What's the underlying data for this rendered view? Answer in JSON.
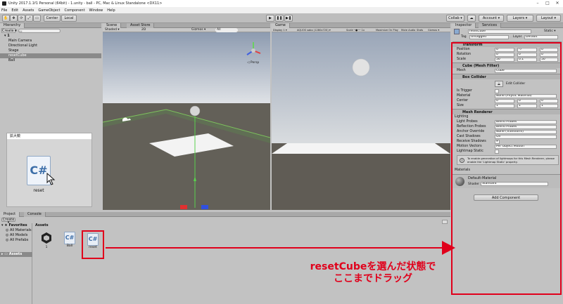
{
  "window": {
    "title": "Unity 2017.1.1f1 Personal (64bit) - 1.unity - ball - PC, Mac & Linux Standalone <DX11>",
    "min": "–",
    "max": "□",
    "close": "✕"
  },
  "menu": [
    "File",
    "Edit",
    "Assets",
    "GameObject",
    "Component",
    "Window",
    "Help"
  ],
  "toolbar": {
    "center": "Center",
    "local": "Local",
    "play": "▶",
    "pause": "❚❚",
    "step": "▶❚",
    "collab": "Collab ▾",
    "account": "Account ▾",
    "layers": "Layers ▾",
    "layout": "Layout ▾",
    "cloud": "☁"
  },
  "hierarchy": {
    "tab": "Hierarchy",
    "create": "Create ▾",
    "search_placeholder": "All",
    "scene": "1",
    "items": [
      "Main Camera",
      "Directional Light",
      "Stage",
      "resetCube",
      "Ball"
    ],
    "selected": 3
  },
  "scene": {
    "tab": "Scene",
    "asset_store": "Asset Store",
    "shading": "Shaded ▾",
    "mode2d": "2D",
    "gizmos": "Gizmos ▾",
    "search": "All",
    "persp": "◁ Persp"
  },
  "game": {
    "tab": "Game",
    "display": "Display 1 ▾",
    "aspect": "AQUOS sabo (1280x720) ▾",
    "scale": "Scale ─●── 1x",
    "maximize": "Maximize On Play",
    "mute": "Mute Audio",
    "stats": "Stats",
    "gizmos": "Gizmos ▾"
  },
  "zoom": {
    "title": "拡大鏡",
    "file_icon": "C#",
    "file_label": "reset"
  },
  "inspector": {
    "tab": "Inspector",
    "services": "Services",
    "object": "resetCube",
    "static": "Static ▾",
    "tag_label": "Tag",
    "tag": "Untagged",
    "layer_label": "Layer",
    "layer": "Default",
    "transform": {
      "title": "Transform",
      "rows": [
        {
          "label": "Position",
          "x": "0",
          "y": "-7",
          "z": "0"
        },
        {
          "label": "Rotation",
          "x": "0",
          "y": "0",
          "z": "0"
        },
        {
          "label": "Scale",
          "x": "50",
          "y": "0.1",
          "z": "50"
        }
      ]
    },
    "meshfilter": {
      "title": "Cube (Mesh Filter)",
      "label": "Mesh",
      "value": "Cube"
    },
    "boxcollider": {
      "title": "Box Collider",
      "edit": "Edit Collider",
      "is_trigger": "Is Trigger",
      "material": "Material",
      "material_value": "None (Physic Material)",
      "center": {
        "label": "Center",
        "x": "0",
        "y": "0",
        "z": "0"
      },
      "size": {
        "label": "Size",
        "x": "1",
        "y": "1",
        "z": "1"
      }
    },
    "meshrenderer": {
      "title": "Mesh Renderer",
      "lighting": "Lighting",
      "rows": [
        {
          "label": "Light Probes",
          "value": "Blend Probes"
        },
        {
          "label": "Reflection Probes",
          "value": "Blend Probes"
        },
        {
          "label": "Anchor Override",
          "value": "None (Transform)"
        },
        {
          "label": "Cast Shadows",
          "value": "On"
        },
        {
          "label": "Receive Shadows",
          "value": "✔"
        },
        {
          "label": "Motion Vectors",
          "value": "Per Object Motion"
        },
        {
          "label": "Lightmap Static",
          "value": ""
        }
      ],
      "info": "To enable generation of lightmaps for this Mesh Renderer, please enable the 'Lightmap Static' property."
    },
    "materials_label": "Materials",
    "material": {
      "name": "Default-Material",
      "shader_label": "Shader",
      "shader": "Standard"
    },
    "add_component": "Add Component"
  },
  "project": {
    "tab": "Project",
    "console": "Console",
    "create": "Create ▾",
    "favorites": "Favorites",
    "fav_items": [
      "All Materials",
      "All Models",
      "All Prefabs"
    ],
    "assets_root": "Assets",
    "breadcrumb": "Assets",
    "files": [
      {
        "name": "1",
        "type": "unity"
      },
      {
        "name": "Ball",
        "type": "cs"
      },
      {
        "name": "reset",
        "type": "cs"
      }
    ]
  },
  "annotation": {
    "line1": "resetCubeを選んだ状態で",
    "line2": "ここまでドラッグ",
    "color": "#e0001b"
  }
}
